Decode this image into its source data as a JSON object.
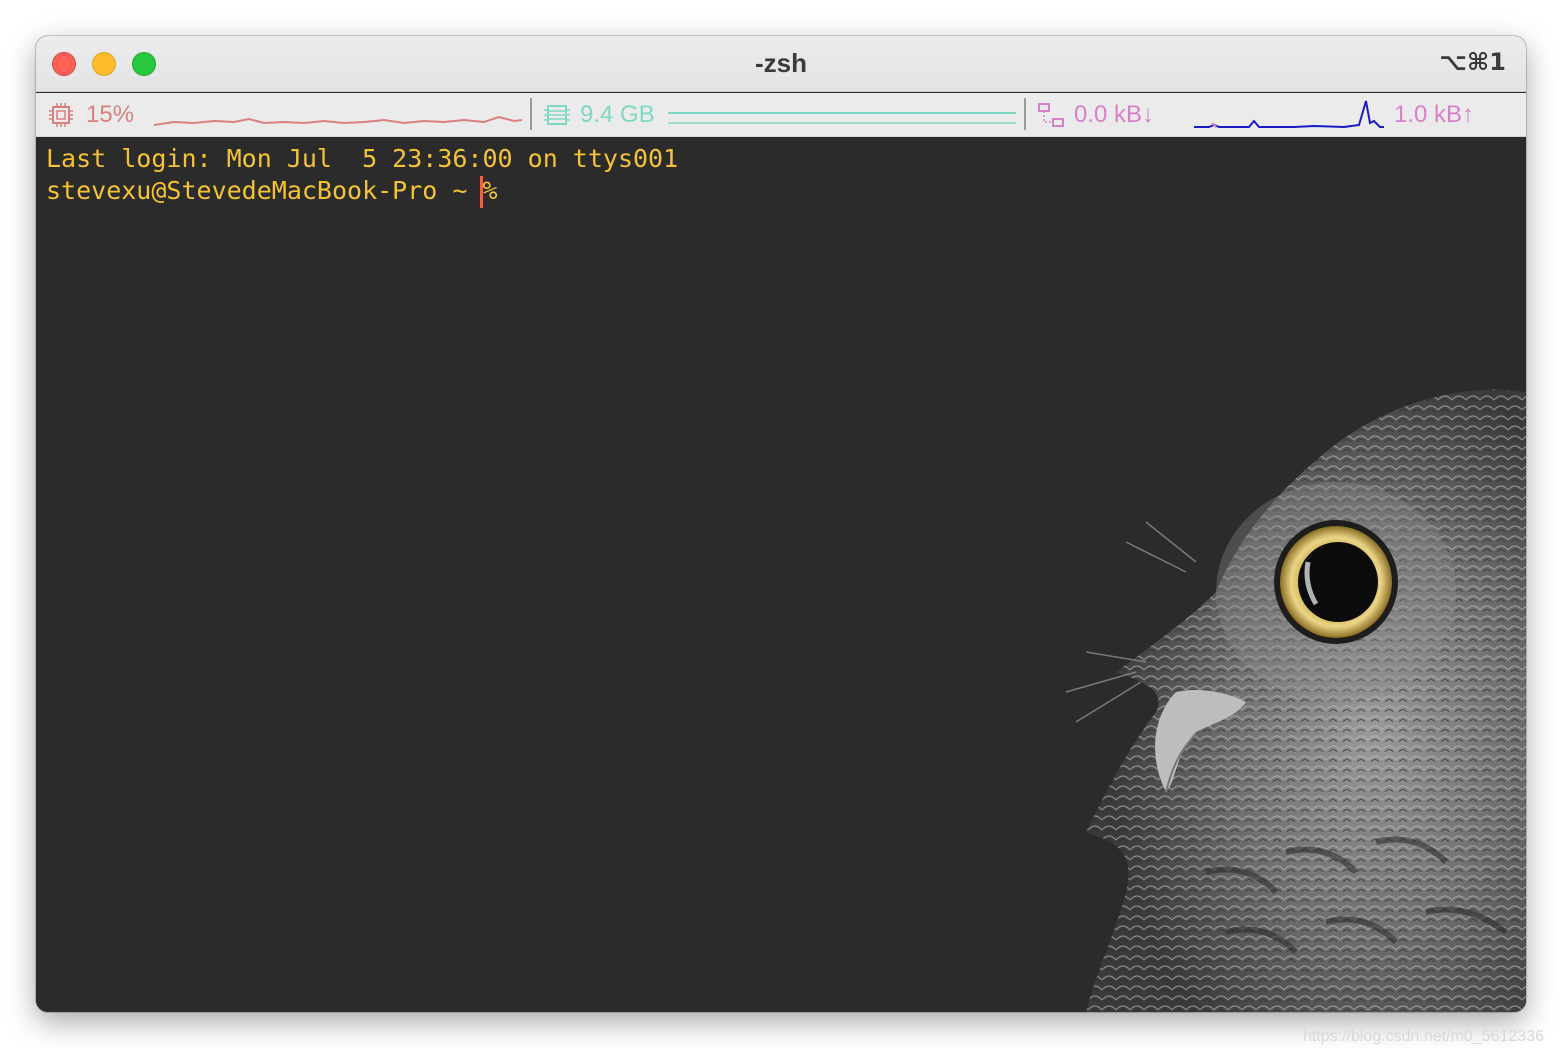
{
  "window": {
    "title": "-zsh",
    "shortcut": "⌥⌘1"
  },
  "statusbar": {
    "cpu": {
      "icon": "cpu-icon",
      "value": "15%",
      "color": "#d9807f"
    },
    "memory": {
      "icon": "memory-icon",
      "value": "9.4 GB",
      "color": "#7fd8c3"
    },
    "network": {
      "icon": "network-icon",
      "download": "0.0 kB↓",
      "upload": "1.0 kB↑",
      "color": "#d780c9",
      "graph_color": "#1a1ac8"
    }
  },
  "terminal": {
    "lines": [
      "Last login: Mon Jul  5 23:36:00 on ttys001",
      "stevexu@StevedeMacBook-Pro ~ % "
    ],
    "text_color": "#f4c432",
    "cursor_color": "#ff5b3b",
    "background_image": "owl-illustration"
  },
  "watermark": "https://blog.csdn.net/m0_5612336"
}
